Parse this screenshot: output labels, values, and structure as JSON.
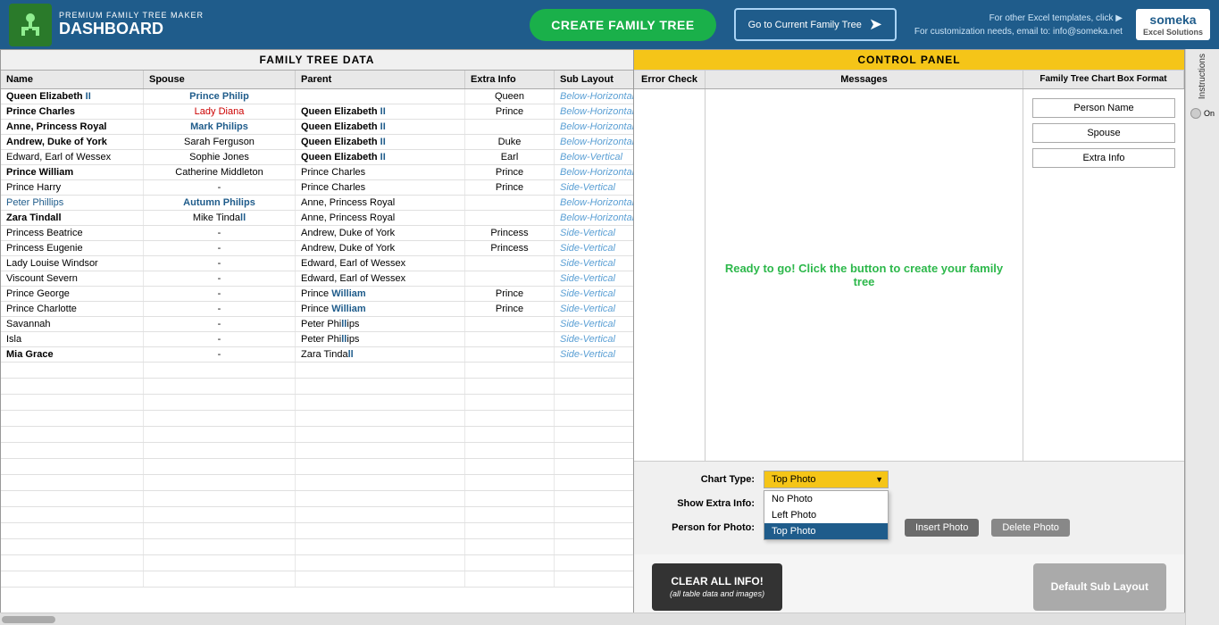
{
  "header": {
    "premium_label": "PREMIUM FAMILY TREE MAKER",
    "dashboard_label": "DASHBOARD",
    "create_btn_label": "CREATE FAMILY TREE",
    "goto_btn_label": "Go to Current Family Tree",
    "header_note_line1": "For other Excel templates, click ▶",
    "header_note_line2": "For customization needs, email to: info@someka.net",
    "someka_label": "someka",
    "excel_label": "Excel Solutions",
    "instructions_label": "Instructions"
  },
  "left_panel": {
    "title": "FAMILY TREE DATA",
    "columns": [
      "Name",
      "Spouse",
      "Parent",
      "Extra Info",
      "Sub Layout"
    ],
    "rows": [
      {
        "name": "Queen Elizabeth II",
        "name_bold": true,
        "spouse": "Prince Philip",
        "spouse_blue": true,
        "parent": "",
        "extra_info": "Queen",
        "sub_layout": "Below-Horizontal"
      },
      {
        "name": "Prince Charles",
        "name_bold": true,
        "spouse": "Lady Diana",
        "spouse_red": true,
        "parent": "Queen Elizabeth II",
        "parent_bold": true,
        "extra_info": "Prince",
        "sub_layout": "Below-Horizontal"
      },
      {
        "name": "Anne, Princess Royal",
        "name_bold": true,
        "spouse": "Mark Philips",
        "spouse_blue": true,
        "parent": "Queen Elizabeth II",
        "parent_bold": true,
        "extra_info": "",
        "sub_layout": "Below-Horizontal"
      },
      {
        "name": "Andrew, Duke of York",
        "name_bold": true,
        "spouse": "Sarah Ferguson",
        "parent": "Queen Elizabeth II",
        "parent_bold": true,
        "extra_info": "Duke",
        "sub_layout": "Below-Horizontal"
      },
      {
        "name": "Edward, Earl of Wessex",
        "spouse": "Sophie Jones",
        "parent": "Queen Elizabeth II",
        "parent_bold": true,
        "extra_info": "Earl",
        "sub_layout": "Below-Vertical"
      },
      {
        "name": "Prince William",
        "name_bold": true,
        "spouse": "Catherine Middleton",
        "parent": "Prince Charles",
        "extra_info": "Prince",
        "sub_layout": "Below-Horizontal"
      },
      {
        "name": "Prince Harry",
        "spouse": "-",
        "parent": "Prince Charles",
        "extra_info": "Prince",
        "sub_layout": "Side-Vertical"
      },
      {
        "name": "Peter Phillips",
        "name_blue": true,
        "spouse": "Autumn Philips",
        "spouse_blue": true,
        "parent": "Anne, Princess Royal",
        "extra_info": "",
        "sub_layout": "Below-Horizontal"
      },
      {
        "name": "Zara Tindall",
        "name_bold": true,
        "spouse": "Mike Tindall",
        "spouse_bold": true,
        "parent": "Anne, Princess Royal",
        "extra_info": "",
        "sub_layout": "Below-Horizontal"
      },
      {
        "name": "Princess Beatrice",
        "spouse": "-",
        "parent": "Andrew, Duke of York",
        "extra_info": "Princess",
        "sub_layout": "Side-Vertical"
      },
      {
        "name": "Princess Eugenie",
        "spouse": "-",
        "parent": "Andrew, Duke of York",
        "extra_info": "Princess",
        "sub_layout": "Side-Vertical"
      },
      {
        "name": "Lady Louise Windsor",
        "spouse": "-",
        "parent": "Edward, Earl of Wessex",
        "extra_info": "",
        "sub_layout": "Side-Vertical"
      },
      {
        "name": "Viscount Severn",
        "spouse": "-",
        "parent": "Edward, Earl of Wessex",
        "extra_info": "",
        "sub_layout": "Side-Vertical"
      },
      {
        "name": "Prince George",
        "spouse": "-",
        "parent": "Prince William",
        "extra_info": "Prince",
        "sub_layout": "Side-Vertical"
      },
      {
        "name": "Prince Charlotte",
        "spouse": "-",
        "parent": "Prince William",
        "extra_info": "Prince",
        "sub_layout": "Side-Vertical"
      },
      {
        "name": "Savannah",
        "spouse": "-",
        "parent": "Peter Phillips",
        "extra_info": "",
        "sub_layout": "Side-Vertical"
      },
      {
        "name": "Isla",
        "spouse": "-",
        "parent": "Peter Phillips",
        "extra_info": "",
        "sub_layout": "Side-Vertical"
      },
      {
        "name": "Mia Grace",
        "spouse": "-",
        "parent": "Zara Tindall",
        "name_bold": true,
        "extra_info": "",
        "sub_layout": "Side-Vertical"
      }
    ]
  },
  "right_panel": {
    "title": "CONTROL PANEL",
    "col_error_check": "Error Check",
    "col_messages": "Messages",
    "col_chart_format": "Family Tree Chart Box Format",
    "ready_message": "Ready to go! Click the button to create your family tree",
    "format_boxes": [
      "Person Name",
      "Spouse",
      "Extra Info"
    ],
    "chart_type_label": "Chart Type:",
    "chart_type_value": "Top Photo",
    "chart_type_options": [
      "No Photo",
      "Left Photo",
      "Top Photo"
    ],
    "show_extra_info_label": "Show Extra Info:",
    "toggle_label": "On",
    "person_for_photo_label": "Person for Photo:",
    "person_for_photo_value": "",
    "insert_photo_btn": "Insert Photo",
    "delete_photo_btn": "Delete Photo",
    "clear_btn_line1": "CLEAR ALL INFO!",
    "clear_btn_line2": "(all table data and images)",
    "default_layout_btn": "Default Sub Layout"
  }
}
